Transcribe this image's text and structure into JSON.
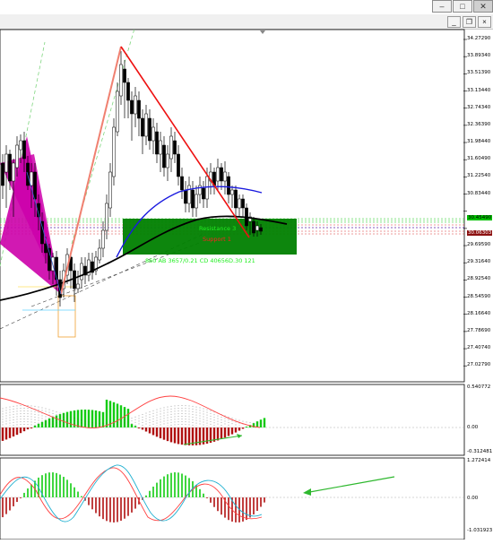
{
  "window": {
    "min_icon": "minimize-icon",
    "max_icon": "maximize-icon",
    "close_icon": "close-icon",
    "min_glyph": "–",
    "max_glyph": "□",
    "close_glyph": "✕",
    "mdi_min_glyph": "_",
    "mdi_restore_glyph": "❐",
    "mdi_close_glyph": "×"
  },
  "price_axis": {
    "labels": [
      "34.27290",
      "33.89340",
      "33.51390",
      "33.13440",
      "32.74340",
      "32.36390",
      "31.98440",
      "31.60490",
      "31.22540",
      "30.83440",
      "30.45490",
      "30.06303",
      "29.69590",
      "29.31640",
      "28.92540",
      "28.54590",
      "28.16640",
      "27.78690",
      "27.40740",
      "27.02790"
    ],
    "current_price": "30.06303",
    "green_line_label": "30.45490"
  },
  "macd_axis": {
    "top": "0.540772",
    "zero": "0.00",
    "bottom": "-0.312481"
  },
  "osc_axis": {
    "top": "1.272414",
    "zero": "0.00",
    "bottom": "-1.031923"
  },
  "chart_labels": {
    "resistance": "Resistance 3",
    "support": "Support 1",
    "pattern_stats": "860    AB 3657/0.21 CD 40656D.30    121"
  },
  "colors": {
    "up_candle": "#ffffff",
    "down_candle": "#000000",
    "zone_green": "#008000",
    "harmonic_magenta": "#cc00aa",
    "ma_black": "#000000",
    "ma_blue": "#1a1adf",
    "leg_red": "#ee1111",
    "leg_salmon": "#f08070",
    "macd_red": "#b01010",
    "macd_green": "#11cc11",
    "signal_red": "#ff4040",
    "osc_cyan": "#20b0d0",
    "arrow_green": "#2eb82e"
  }
}
